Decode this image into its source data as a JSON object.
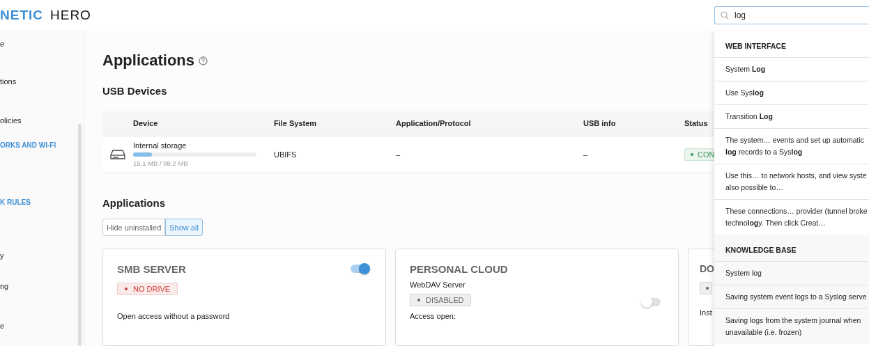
{
  "logo": {
    "part_1": "NETIC",
    "part_2": "HERO"
  },
  "search": {
    "value": "log"
  },
  "sidebar": {
    "items": [
      {
        "label": "e",
        "kind": "item"
      },
      {
        "label": "tions",
        "kind": "item"
      },
      {
        "label": "olicies",
        "kind": "item"
      },
      {
        "label": "ORKS AND WI-FI",
        "kind": "section"
      },
      {
        "label": "K RULES",
        "kind": "section"
      },
      {
        "label": "y",
        "kind": "item"
      },
      {
        "label": "ng",
        "kind": "item"
      },
      {
        "label": "e",
        "kind": "item"
      }
    ]
  },
  "page": {
    "title": "Applications"
  },
  "usb": {
    "title": "USB Devices",
    "columns": [
      "Device",
      "File System",
      "Application/Protocol",
      "USB info",
      "Status"
    ],
    "rows": [
      {
        "device": "Internal storage",
        "level": 0.15,
        "usage": "15.1 MB / 98.2 MB",
        "file_system": "UBIFS",
        "protocol": "–",
        "usb_info": "–",
        "status": "CON",
        "color": "#3c9a5b"
      }
    ]
  },
  "applications": {
    "title": "Applications",
    "filters": [
      {
        "label": "Hide uninstalled",
        "selected": false
      },
      {
        "label": "Show all",
        "selected": true
      }
    ],
    "cards": [
      {
        "title": "SMB SERVER",
        "on": true,
        "kind": "simple",
        "badge": "NO DRIVE",
        "color": "#d23a3a",
        "text": "Open access without a password"
      },
      {
        "title": "PERSONAL CLOUD",
        "on": false,
        "kind": "service",
        "subtitle": "WebDAV Server",
        "badge": "DISABLED",
        "color": "#666666",
        "text": "Access open:"
      },
      {
        "title": "DO",
        "kind": "partial",
        "color": "#666666",
        "text": "Inst"
      }
    ]
  },
  "results": {
    "sections": [
      {
        "title": "WEB INTERFACE",
        "items": [
          "System **Log**",
          "Use Sys**log**",
          "Transition **Log**",
          "The system… events and set up automatic\n**log** records to a Sys**log**",
          "Use this… to network hosts, and view syste\nalso possible to…",
          "These connections… provider (tunnel broke\ntechno**log**y. Then click Creat…"
        ]
      },
      {
        "title": "KNOWLEDGE BASE",
        "items": [
          "System log",
          "Saving system event logs to a Syslog serve",
          "Saving logs from the system journal when\nunavailable (i.e. frozen)"
        ]
      }
    ]
  }
}
